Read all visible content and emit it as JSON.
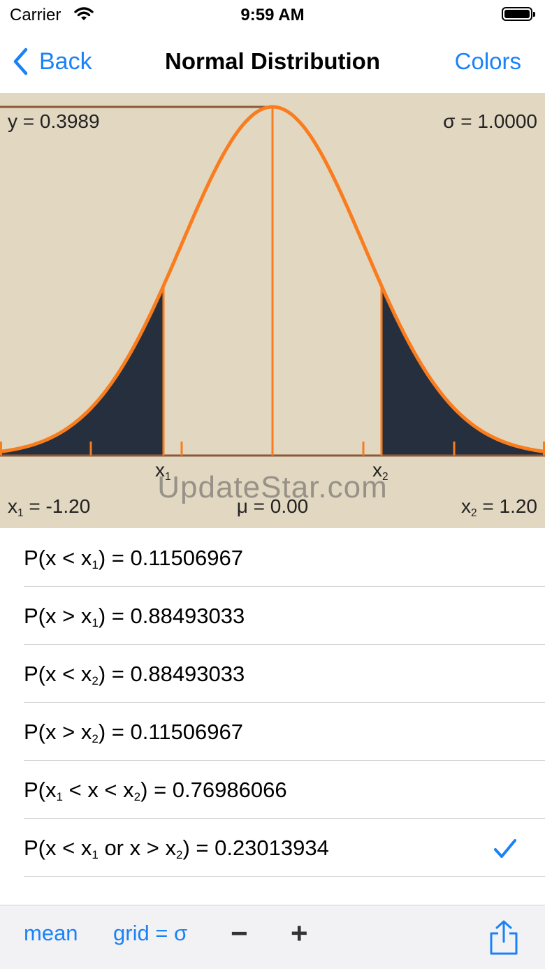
{
  "status_bar": {
    "carrier": "Carrier",
    "time": "9:59 AM"
  },
  "nav": {
    "back_label": "Back",
    "title": "Normal Distribution",
    "colors_label": "Colors"
  },
  "chart": {
    "y_label": "y = 0.3989",
    "sigma_label": "σ = 1.0000",
    "x1_marker": "x",
    "x1_marker_sub": "1",
    "x2_marker": "x",
    "x2_marker_sub": "2",
    "x1_label": "x",
    "x1_label_sub": "1",
    "x1_value": " = -1.20",
    "mu_label": "μ = 0.00",
    "x2_label": "x",
    "x2_label_sub": "2",
    "x2_value": " = 1.20",
    "watermark": "UpdateStar.com",
    "colors": {
      "background": "#e2d7c0",
      "curve": "#f97d1e",
      "shade": "#252f3e",
      "axis": "#8a5a3a"
    }
  },
  "chart_data": {
    "type": "area",
    "mean": 0.0,
    "sigma": 1.0,
    "peak_y": 0.3989,
    "x1": -1.2,
    "x2": 1.2,
    "xlim": [
      -3.0,
      3.0
    ],
    "ylim": [
      0,
      0.3989
    ],
    "shaded": "tails"
  },
  "probabilities": [
    {
      "prefix": "P(x < x",
      "sub1": "1",
      "mid": "",
      "sub2": "",
      "suffix": ") = 0.11506967"
    },
    {
      "prefix": "P(x > x",
      "sub1": "1",
      "mid": "",
      "sub2": "",
      "suffix": ") = 0.88493033"
    },
    {
      "prefix": "P(x < x",
      "sub1": "2",
      "mid": "",
      "sub2": "",
      "suffix": ") = 0.88493033"
    },
    {
      "prefix": "P(x > x",
      "sub1": "2",
      "mid": "",
      "sub2": "",
      "suffix": ") = 0.11506967"
    },
    {
      "prefix": "P(x",
      "sub1": "1",
      "mid": " < x < x",
      "sub2": "2",
      "suffix": ") = 0.76986066"
    },
    {
      "prefix": "P(x < x",
      "sub1": "1",
      "mid": " or x > x",
      "sub2": "2",
      "suffix": ") = 0.23013934"
    }
  ],
  "selected_row": 5,
  "toolbar": {
    "mean_label": "mean",
    "grid_label": "grid = σ",
    "minus_label": "−",
    "plus_label": "+"
  },
  "icons": {
    "back": "chevron-left-icon",
    "check": "checkmark-icon",
    "share": "share-icon",
    "wifi": "wifi-icon",
    "battery": "battery-icon"
  }
}
